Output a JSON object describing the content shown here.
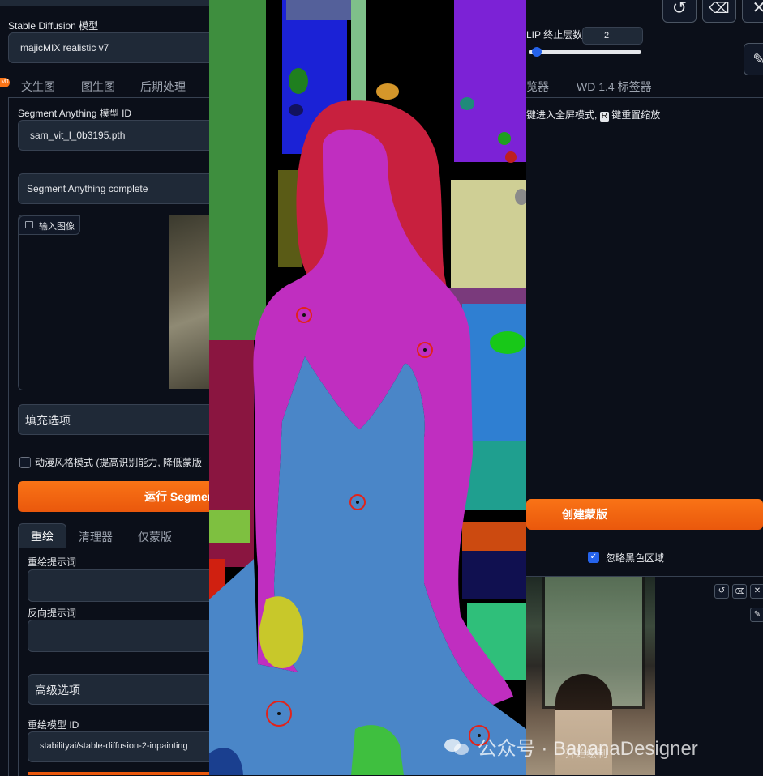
{
  "left": {
    "model_label": "Stable Diffusion 模型",
    "model_value": "majicMIX realistic v7",
    "badge": "MJ",
    "tabs": [
      "文生图",
      "图生图",
      "后期处理"
    ],
    "sam_label": "Segment Anything 模型 ID",
    "sam_value": "sam_vit_l_0b3195.pth",
    "sam_complete": "Segment Anything complete",
    "input_image_label": "输入图像",
    "fill_options": "填充选项",
    "anime_checkbox": "动漫风格模式 (提高识别能力, 降低蒙版",
    "run_button": "运行 Segment",
    "sub_tabs": [
      "重绘",
      "清理器",
      "仅蒙版"
    ],
    "inpaint_prompt_label": "重绘提示词",
    "negative_prompt_label": "反向提示词",
    "advanced_options": "高级选项",
    "inpaint_model_label": "重绘模型 ID",
    "inpaint_model_value": "stabilityai/stable-diffusion-2-inpainting"
  },
  "right": {
    "clip_label": "LIP 终止层数",
    "clip_value": "2",
    "clip_fraction": 0.03,
    "tabs": [
      "览器",
      "WD 1.4 标签器"
    ],
    "hint_prefix": "键进入全屏模式,",
    "hint_key": "R",
    "hint_suffix": "键重置缩放",
    "create_mask_button": "创建蒙版",
    "ignore_black_label": "忽略黑色区域",
    "ignore_black_checked": true,
    "overlay_caption": "开始绘制"
  },
  "watermark": "公众号 · BananaDesigner",
  "icons": {
    "undo": "undo-icon",
    "eraser": "eraser-icon",
    "close": "close-icon",
    "brush": "brush-icon",
    "image": "image-icon"
  }
}
